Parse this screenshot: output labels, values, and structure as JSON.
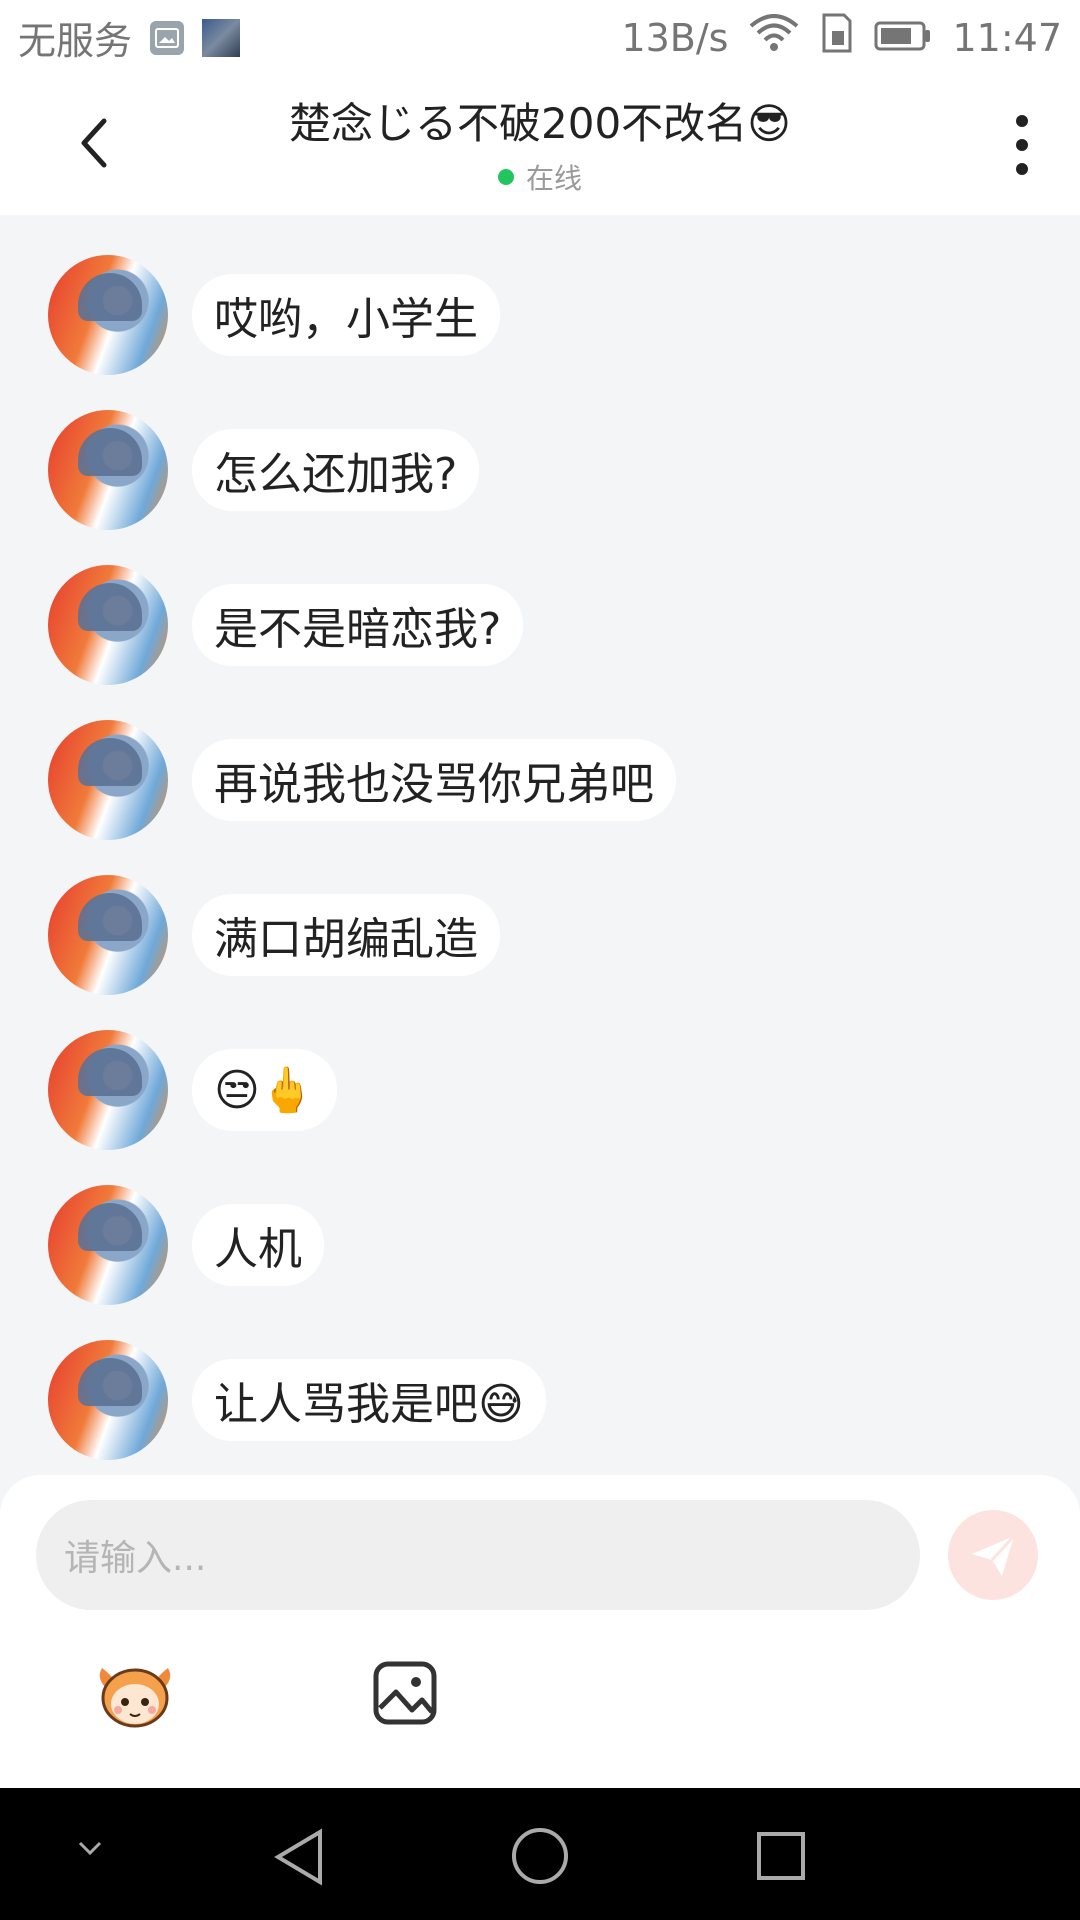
{
  "status_bar": {
    "carrier": "无服务",
    "speed": "13B/s",
    "time": "11:47"
  },
  "header": {
    "title": "楚念じる不破200不改名😎",
    "status": "在线",
    "status_color": "#22c55e"
  },
  "messages": [
    {
      "text": "哎哟，小学生"
    },
    {
      "text": "怎么还加我?"
    },
    {
      "text": "是不是暗恋我?"
    },
    {
      "text": "再说我也没骂你兄弟吧"
    },
    {
      "text": "满口胡编乱造"
    },
    {
      "text": "😒🖕"
    },
    {
      "text": "人机"
    },
    {
      "text": "让人骂我是吧😅"
    }
  ],
  "composer": {
    "placeholder": "请输入...",
    "send_button_color": "#fde3df"
  },
  "icons": {
    "back": "back-arrow-icon",
    "more": "more-vertical-icon",
    "emoji": "emoji-mascot-icon",
    "image": "image-icon",
    "send": "send-icon"
  }
}
